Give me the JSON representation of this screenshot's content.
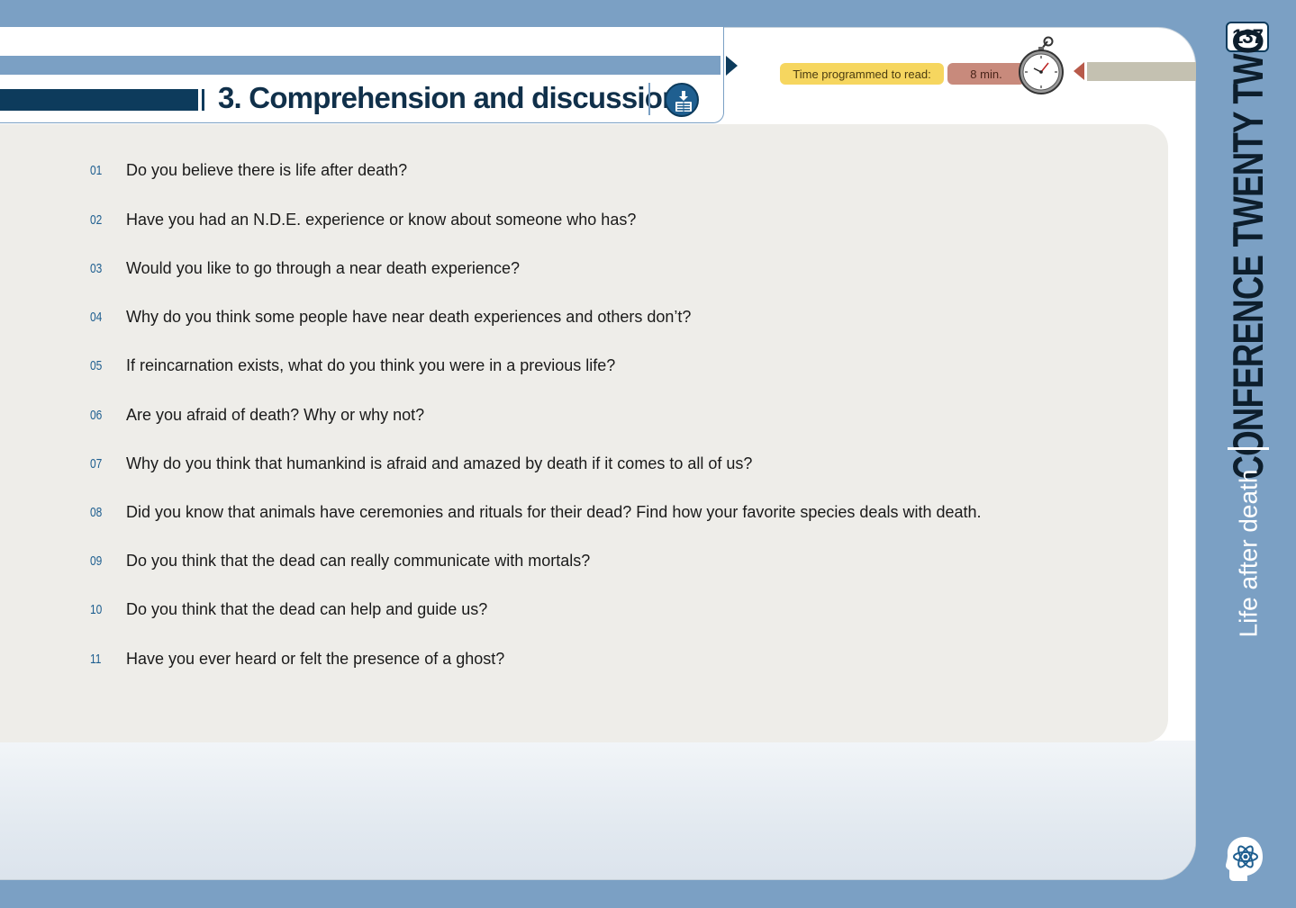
{
  "header": {
    "section_title": "3. Comprehension and discussion",
    "time_label": "Time programmed to read:",
    "time_value": "8 min."
  },
  "questions": [
    {
      "num": "01",
      "text": "Do you believe there is life after death?"
    },
    {
      "num": "02",
      "text": "Have you had an N.D.E. experience or know about someone who has?"
    },
    {
      "num": "03",
      "text": "Would you like to go through a near death experience?"
    },
    {
      "num": "04",
      "text": "Why do you think some people have near death experiences and others don’t?"
    },
    {
      "num": "05",
      "text": "If reincarnation exists, what do you think you were in a previous life?"
    },
    {
      "num": "06",
      "text": "Are you afraid of death? Why or why not?"
    },
    {
      "num": "07",
      "text": "Why do you think that humankind is afraid and amazed by death if it comes to all of us?"
    },
    {
      "num": "08",
      "text": "Did you know that animals have ceremonies and rituals for their dead? Find how your favorite species deals with death."
    },
    {
      "num": "09",
      "text": "Do you think that the dead can really communicate with mortals?"
    },
    {
      "num": "10",
      "text": "Do you think that the dead can help and guide us?"
    },
    {
      "num": "11",
      "text": "Have you ever heard or felt the presence of a ghost?"
    }
  ],
  "sidebar": {
    "page_number": "137",
    "chapter": "CONFERENCE TWENTY TWO",
    "subtitle": "Life after death"
  },
  "icons": {
    "download": "download-icon",
    "stopwatch": "stopwatch-icon",
    "logo": "brain-atom-logo-icon"
  },
  "colors": {
    "accent_dark": "#0d3b5c",
    "accent_blue": "#7ba0c4",
    "time_label_bg": "#f6d65f",
    "time_value_bg": "#c88a7c"
  }
}
